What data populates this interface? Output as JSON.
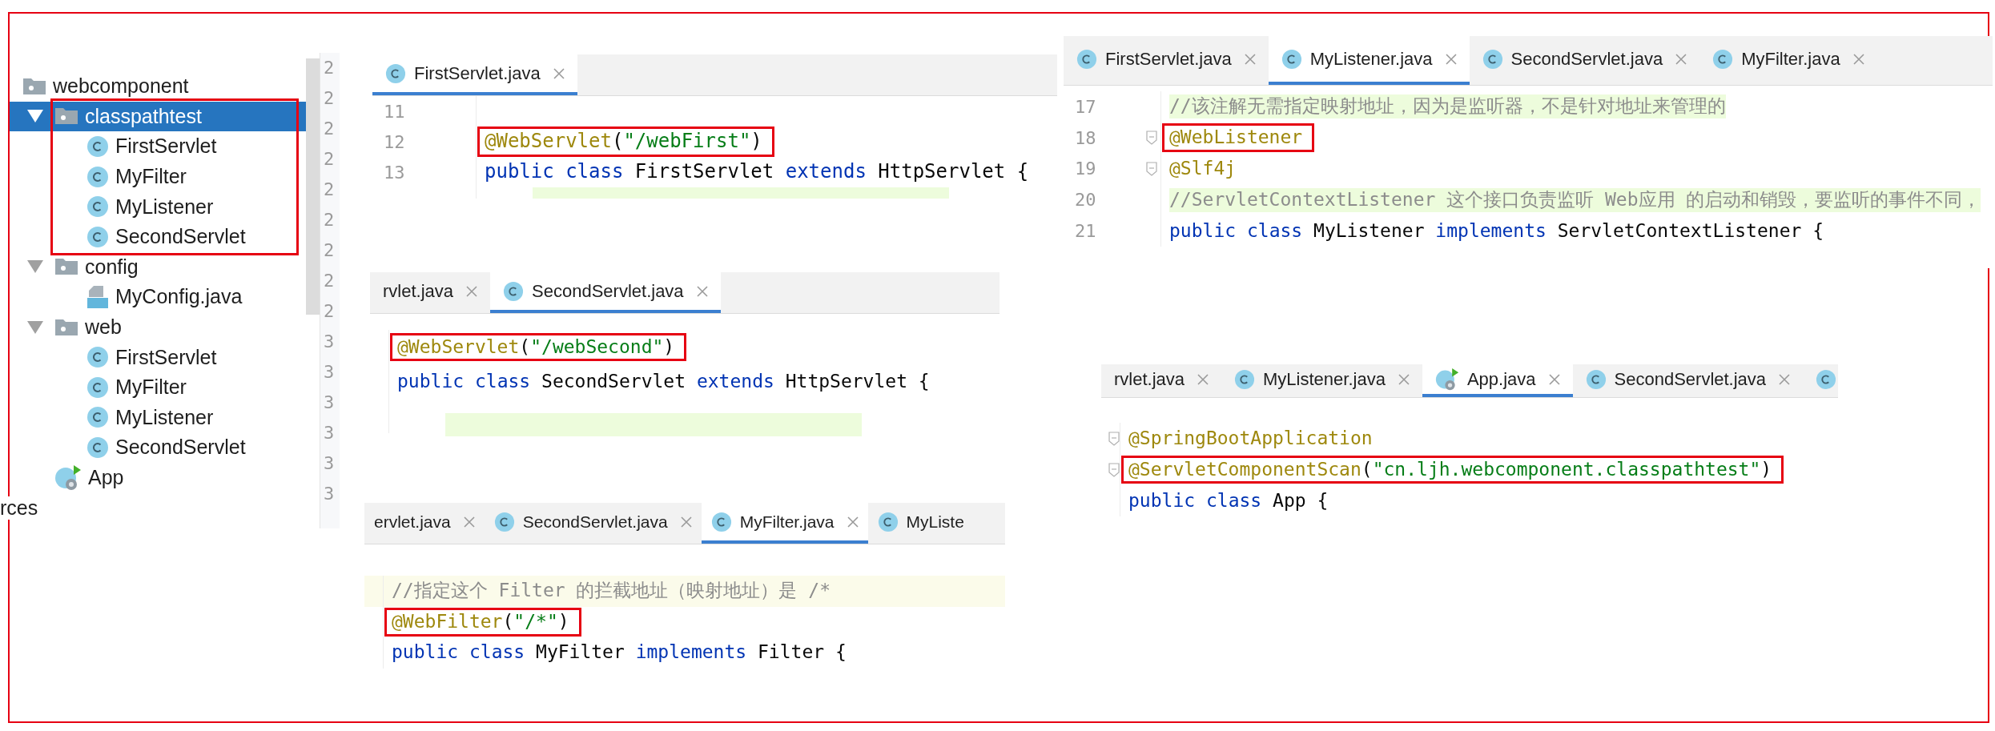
{
  "project_tree": {
    "gutter_numbers": [
      "2",
      "2",
      "2",
      "2",
      "2",
      "2",
      "2",
      "2",
      "2",
      "3",
      "3",
      "3",
      "3",
      "3",
      "3"
    ],
    "items": [
      {
        "label": "webcomponent",
        "kind": "package",
        "selected": false,
        "children": [
          {
            "label": "classpathtest",
            "kind": "package",
            "selected": true,
            "expanded": true,
            "boxed": true,
            "children": [
              {
                "label": "FirstServlet",
                "kind": "class",
                "selected": false
              },
              {
                "label": "MyFilter",
                "kind": "class",
                "selected": false
              },
              {
                "label": "MyListener",
                "kind": "class",
                "selected": false
              },
              {
                "label": "SecondServlet",
                "kind": "class",
                "selected": false
              }
            ]
          },
          {
            "label": "config",
            "kind": "package",
            "selected": false,
            "expanded": true,
            "children": [
              {
                "label": "MyConfig.java",
                "kind": "java_file",
                "selected": false
              }
            ]
          },
          {
            "label": "web",
            "kind": "package",
            "selected": false,
            "expanded": true,
            "children": [
              {
                "label": "FirstServlet",
                "kind": "class",
                "selected": false
              },
              {
                "label": "MyFilter",
                "kind": "class",
                "selected": false
              },
              {
                "label": "MyListener",
                "kind": "class",
                "selected": false
              },
              {
                "label": "SecondServlet",
                "kind": "class",
                "selected": false
              }
            ]
          },
          {
            "label": "App",
            "kind": "app",
            "selected": false
          }
        ]
      }
    ],
    "cut_label": "rces"
  },
  "editors": [
    {
      "tabs": [
        {
          "label": "FirstServlet.java",
          "kind": "class",
          "selected": true,
          "closable": true
        }
      ],
      "lines": [
        {
          "number": "11"
        },
        {
          "number": "12",
          "boxed": true,
          "tokens": [
            {
              "kind": "annotation",
              "text": "@WebServlet"
            },
            {
              "kind": "plain",
              "text": "("
            },
            {
              "kind": "string",
              "text": "\"/webFirst\""
            },
            {
              "kind": "plain",
              "text": ")"
            }
          ]
        },
        {
          "number": "13",
          "tokens": [
            {
              "kind": "keyword",
              "text": "public "
            },
            {
              "kind": "keyword",
              "text": "class"
            },
            {
              "kind": "plain",
              "text": " FirstServlet "
            },
            {
              "kind": "keyword",
              "text": "extends"
            },
            {
              "kind": "plain",
              "text": " HttpServlet {"
            }
          ]
        },
        {
          "highlighted": true
        }
      ]
    },
    {
      "tabs": [
        {
          "label": "FirstServlet.java",
          "kind": "class",
          "selected": false,
          "closable": true
        },
        {
          "label": "MyListener.java",
          "kind": "class",
          "selected": true,
          "closable": true
        },
        {
          "label": "SecondServlet.java",
          "kind": "class",
          "selected": false,
          "closable": true
        },
        {
          "label": "MyFilter.java",
          "kind": "class",
          "selected": false,
          "closable": true
        }
      ],
      "lines": [
        {
          "number": "17",
          "highlighted": true,
          "tokens": [
            {
              "kind": "comment",
              "text": "//该注解无需指定映射地址，因为是监听器，不是针对地址来管理的"
            }
          ]
        },
        {
          "number": "18",
          "fold": true,
          "boxed": true,
          "tokens": [
            {
              "kind": "annotation",
              "text": "@WebListener"
            }
          ]
        },
        {
          "number": "19",
          "fold": true,
          "tokens": [
            {
              "kind": "annotation",
              "text": "@Slf4j"
            }
          ]
        },
        {
          "number": "20",
          "highlighted": true,
          "tokens": [
            {
              "kind": "comment",
              "text": "//ServletContextListener 这个接口负责监听 Web应用 的启动和销毁，要监听的事件不同，"
            }
          ]
        },
        {
          "number": "21",
          "tokens": [
            {
              "kind": "keyword",
              "text": "public "
            },
            {
              "kind": "keyword",
              "text": "class"
            },
            {
              "kind": "plain",
              "text": " MyListener "
            },
            {
              "kind": "keyword",
              "text": "implements"
            },
            {
              "kind": "plain",
              "text": " ServletContextListener {"
            }
          ]
        }
      ]
    },
    {
      "tabs": [
        {
          "label": "rvlet.java",
          "selected": false,
          "closable": true
        },
        {
          "label": "SecondServlet.java",
          "kind": "class",
          "selected": true,
          "closable": true
        }
      ],
      "lines": [
        {
          "boxed": true,
          "tokens": [
            {
              "kind": "annotation",
              "text": "@WebServlet"
            },
            {
              "kind": "plain",
              "text": "("
            },
            {
              "kind": "string",
              "text": "\"/webSecond\""
            },
            {
              "kind": "plain",
              "text": ")"
            }
          ]
        },
        {
          "tokens": [
            {
              "kind": "keyword",
              "text": "public "
            },
            {
              "kind": "keyword",
              "text": "class"
            },
            {
              "kind": "plain",
              "text": " SecondServlet "
            },
            {
              "kind": "keyword",
              "text": "extends"
            },
            {
              "kind": "plain",
              "text": " HttpServlet {"
            }
          ]
        },
        {
          "highlighted": true
        }
      ]
    },
    {
      "tabs": [
        {
          "label": "ervlet.java",
          "selected": false,
          "closable": true
        },
        {
          "label": "SecondServlet.java",
          "kind": "class",
          "selected": false,
          "closable": true
        },
        {
          "label": "MyFilter.java",
          "kind": "class",
          "selected": true,
          "closable": true
        },
        {
          "label": "MyListe",
          "kind": "class",
          "selected": false,
          "closable": false
        }
      ],
      "lines": [
        {
          "caret_line": true,
          "tokens": [
            {
              "kind": "comment",
              "text": "//指定这个 Filter 的拦截地址（映射地址）是 /*"
            }
          ]
        },
        {
          "boxed": true,
          "tokens": [
            {
              "kind": "annotation",
              "text": "@WebFilter"
            },
            {
              "kind": "plain",
              "text": "("
            },
            {
              "kind": "string",
              "text": "\"/*\""
            },
            {
              "kind": "plain",
              "text": ")"
            }
          ]
        },
        {
          "tokens": [
            {
              "kind": "keyword",
              "text": "public "
            },
            {
              "kind": "keyword",
              "text": "class"
            },
            {
              "kind": "plain",
              "text": " MyFilter "
            },
            {
              "kind": "keyword",
              "text": "implements"
            },
            {
              "kind": "plain",
              "text": " Filter {"
            }
          ]
        }
      ]
    },
    {
      "tabs": [
        {
          "label": "rvlet.java",
          "selected": false,
          "closable": true
        },
        {
          "label": "MyListener.java",
          "kind": "class",
          "selected": false,
          "closable": true
        },
        {
          "label": "App.java",
          "kind": "app",
          "selected": true,
          "closable": true
        },
        {
          "label": "SecondServlet.java",
          "kind": "class",
          "selected": false,
          "closable": true
        },
        {
          "kind": "class",
          "selected": false,
          "closable": false
        }
      ],
      "lines": [
        {
          "fold": true,
          "tokens": [
            {
              "kind": "annotation",
              "text": "@SpringBootApplication"
            }
          ]
        },
        {
          "fold": true,
          "boxed": true,
          "tokens": [
            {
              "kind": "annotation",
              "text": "@ServletComponentScan"
            },
            {
              "kind": "plain",
              "text": "("
            },
            {
              "kind": "string",
              "text": "\"cn.ljh.webcomponent.classpathtest\""
            },
            {
              "kind": "plain",
              "text": ")"
            }
          ]
        },
        {
          "tokens": [
            {
              "kind": "keyword",
              "text": "public "
            },
            {
              "kind": "keyword",
              "text": "class"
            },
            {
              "kind": "plain",
              "text": " App {"
            }
          ]
        }
      ]
    }
  ]
}
